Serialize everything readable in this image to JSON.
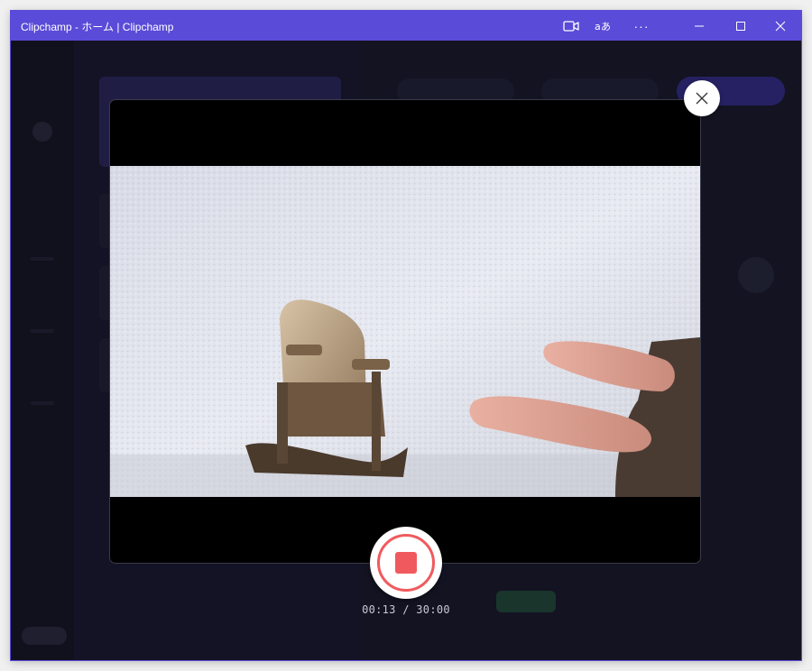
{
  "window": {
    "title": "Clipchamp - ホーム | Clipchamp",
    "accent_color": "#5a4bd8",
    "controls": {
      "camera_icon": "video-camera-icon",
      "translate_icon": "translate-icon",
      "more_label": "···",
      "minimize_icon": "minimize-icon",
      "maximize_icon": "maximize-icon",
      "close_icon": "close-icon"
    }
  },
  "recorder": {
    "close_icon": "close-icon",
    "record_stop_icon": "stop-icon",
    "record_color": "#f05a5e",
    "elapsed": "00:13",
    "limit": "30:00",
    "timer_text": "00:13 / 30:00"
  }
}
